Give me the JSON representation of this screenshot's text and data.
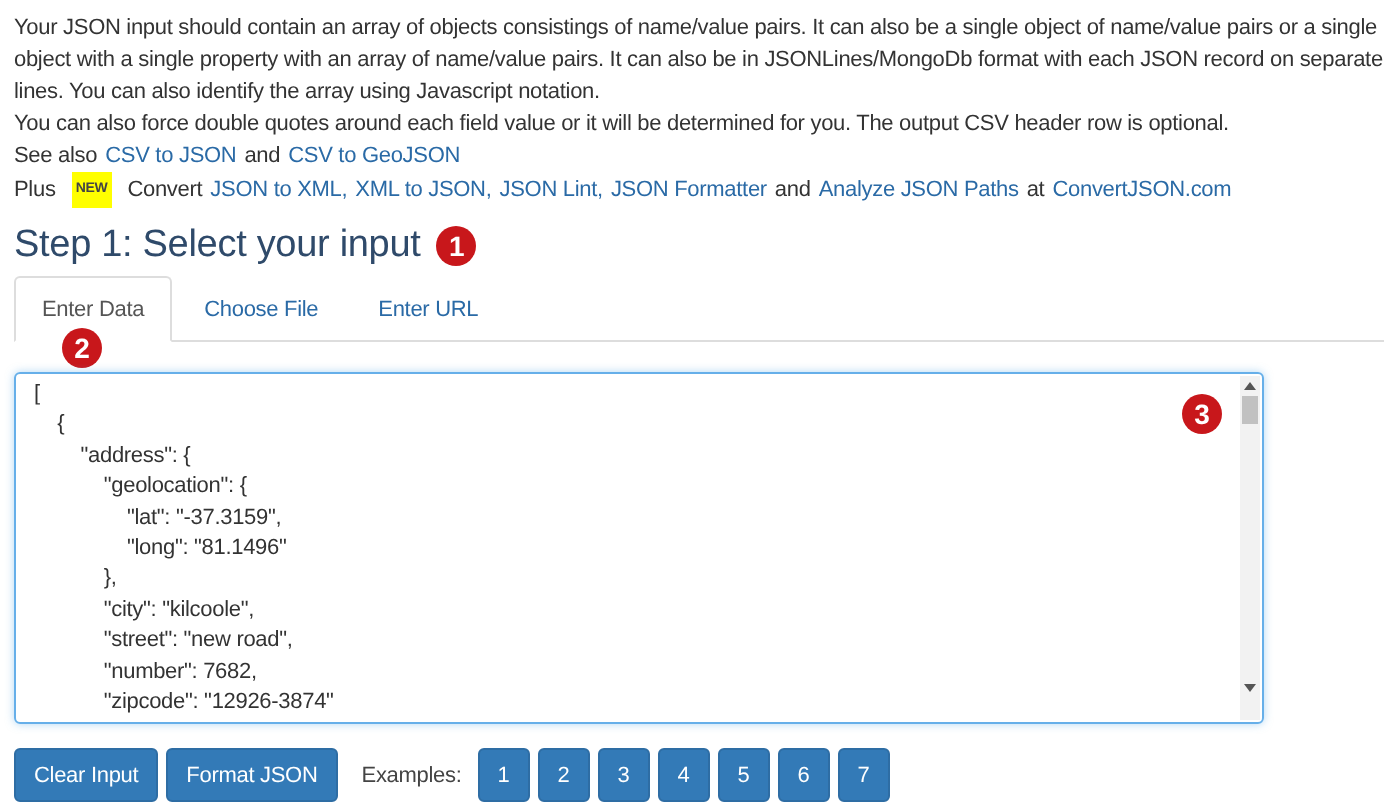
{
  "intro": {
    "paragraph": "Your JSON input should contain an array of objects consistings of name/value pairs. It can also be a single object of name/value pairs or a single object with a single property with an array of name/value pairs. It can also be in JSONLines/MongoDb format with each JSON record on separate lines. You can also identify the array using Javascript notation.",
    "quotes_note": "You can also force double quotes around each field value or it will be determined for you. The output CSV header row is optional.",
    "see_also": [
      {
        "kind": "text",
        "text": "See also"
      },
      {
        "kind": "link",
        "text": "CSV to JSON"
      },
      {
        "kind": "text",
        "text": "and"
      },
      {
        "kind": "link",
        "text": "CSV to GeoJSON"
      }
    ],
    "plus": [
      {
        "kind": "text",
        "text": "Plus"
      },
      {
        "kind": "badge",
        "text": "NEW"
      },
      {
        "kind": "text",
        "text": "Convert"
      },
      {
        "kind": "link",
        "text": "JSON to XML,"
      },
      {
        "kind": "link",
        "text": "XML to JSON,"
      },
      {
        "kind": "link",
        "text": "JSON Lint,"
      },
      {
        "kind": "link",
        "text": "JSON Formatter"
      },
      {
        "kind": "text",
        "text": "and"
      },
      {
        "kind": "link",
        "text": "Analyze JSON Paths"
      },
      {
        "kind": "text",
        "text": "at"
      },
      {
        "kind": "link",
        "text": "ConvertJSON.com"
      }
    ]
  },
  "step": {
    "title": "Step 1: Select your input",
    "callout": "1"
  },
  "tabs": [
    {
      "label": "Enter Data",
      "selected": true,
      "callout": "2"
    },
    {
      "label": "Choose File",
      "selected": false
    },
    {
      "label": "Enter URL",
      "selected": false
    }
  ],
  "editor": {
    "value": "[\n    {\n        \"address\": {\n            \"geolocation\": {\n                \"lat\": \"-37.3159\",\n                \"long\": \"81.1496\"\n            },\n            \"city\": \"kilcoole\",\n            \"street\": \"new road\",\n            \"number\": 7682,\n            \"zipcode\": \"12926-3874\"",
    "callout": "3"
  },
  "buttons": [
    "Clear Input",
    "Format JSON"
  ],
  "examples": {
    "label": "Examples:",
    "items": [
      "1",
      "2",
      "3",
      "4",
      "5",
      "6",
      "7"
    ]
  }
}
